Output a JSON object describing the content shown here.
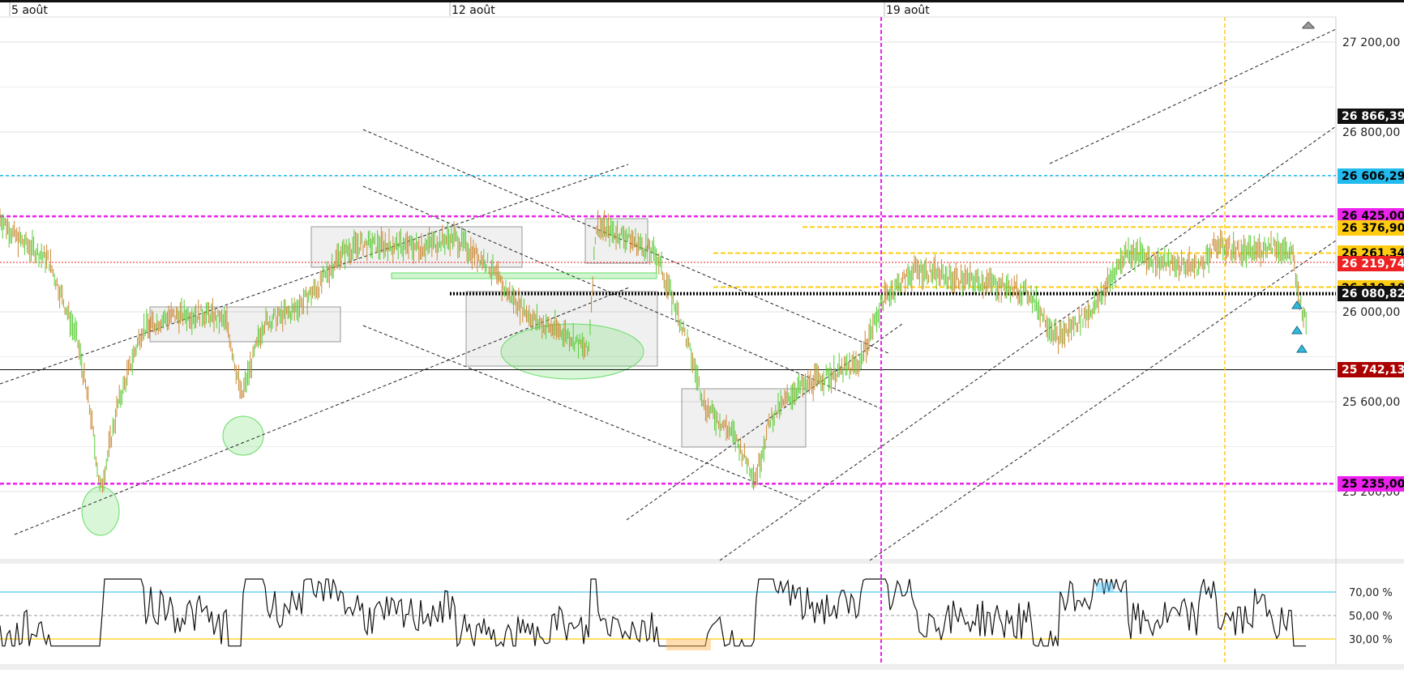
{
  "x_axis": {
    "date_labels": [
      "5 août",
      "12 août",
      "19 août"
    ]
  },
  "price_axis": {
    "tick_labels": [
      "27 200,00",
      "26 800,00",
      "26 000,00",
      "25 600,00",
      "25 200,00"
    ]
  },
  "price_tags": [
    {
      "label": "26 866,39",
      "bg": "#111111",
      "fg": "#ffffff"
    },
    {
      "label": "26 606,29",
      "bg": "#22bbee",
      "fg": "#000000"
    },
    {
      "label": "26 425,00",
      "bg": "#ee22ee",
      "fg": "#000000"
    },
    {
      "label": "26 376,90",
      "bg": "#ffcc11",
      "fg": "#000000"
    },
    {
      "label": "26 261,34",
      "bg": "#ffcc11",
      "fg": "#000000"
    },
    {
      "label": "26 219,74",
      "bg": "#ee2222",
      "fg": "#ffffff"
    },
    {
      "label": "26 110,10",
      "bg": "#ffcc11",
      "fg": "#000000"
    },
    {
      "label": "26 080,82",
      "bg": "#111111",
      "fg": "#ffffff"
    },
    {
      "label": "25 742,13",
      "bg": "#aa0000",
      "fg": "#ffffff"
    },
    {
      "label": "25 235,00",
      "bg": "#ee22ee",
      "fg": "#000000"
    }
  ],
  "oscillator_axis": {
    "tick_labels": [
      "70,00 %",
      "50,00 %",
      "30,00 %"
    ]
  },
  "colors": {
    "candle_up": "#55cc33",
    "candle_down": "#cc8833",
    "magenta": "#ee22ee",
    "yellow": "#ffcc11",
    "cyan": "#22bbee",
    "red": "#ee2222",
    "green_zone": "#66dd66"
  },
  "chart_data": {
    "type": "line",
    "instrument_kind": "intraday price with support/resistance levels and oscillator panel",
    "x_range_dates": [
      "5 août",
      "12 août",
      "19 août"
    ],
    "price_ylim": [
      25000,
      27300
    ],
    "price_levels": [
      26866.39,
      26606.29,
      26425.0,
      26376.9,
      26261.34,
      26219.74,
      26110.1,
      26080.82,
      25742.13,
      25235.0
    ],
    "price_path_keypoints": [
      {
        "x": "5 août",
        "y": 26420
      },
      {
        "x": "~6 août",
        "y": 25200
      },
      {
        "x": "~7 août",
        "y": 25980
      },
      {
        "x": "~8 août",
        "y": 25650
      },
      {
        "x": "~9 août",
        "y": 26320
      },
      {
        "x": "~10 août",
        "y": 26300
      },
      {
        "x": "~12 août",
        "y": 26100
      },
      {
        "x": "~13 août",
        "y": 25820
      },
      {
        "x": "~14 août",
        "y": 26380
      },
      {
        "x": "~15 août",
        "y": 25550
      },
      {
        "x": "~16 août",
        "y": 25260
      },
      {
        "x": "~17 août",
        "y": 25750
      },
      {
        "x": "19 août",
        "y": 26060
      },
      {
        "x": "~20 août",
        "y": 26200
      },
      {
        "x": "~21 août",
        "y": 25880
      },
      {
        "x": "~22 août",
        "y": 26270
      },
      {
        "x": "~23 août",
        "y": 26350
      },
      {
        "x": "~24 août",
        "y": 25742
      }
    ],
    "oscillator": {
      "ylim": [
        0,
        100
      ],
      "levels": [
        70,
        50,
        30
      ],
      "range_observed": [
        25,
        80
      ]
    },
    "grid": true
  }
}
